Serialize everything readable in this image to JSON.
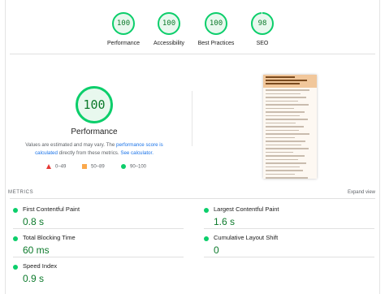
{
  "summary": [
    {
      "score": "100",
      "label": "Performance"
    },
    {
      "score": "100",
      "label": "Accessibility"
    },
    {
      "score": "100",
      "label": "Best Practices"
    },
    {
      "score": "98",
      "label": "SEO"
    }
  ],
  "performance": {
    "score": "100",
    "title": "Performance",
    "disclaimer_pre": "Values are estimated and may vary. The ",
    "disclaimer_link1": "performance score is calculated",
    "disclaimer_mid": " directly from these metrics. ",
    "disclaimer_link2": "See calculator."
  },
  "legend": {
    "fail": "0–49",
    "average": "50–89",
    "pass": "90–100"
  },
  "metrics": {
    "heading": "METRICS",
    "expand": "Expand view",
    "items": [
      {
        "label": "First Contentful Paint",
        "value": "0.8 s"
      },
      {
        "label": "Largest Contentful Paint",
        "value": "1.6 s"
      },
      {
        "label": "Total Blocking Time",
        "value": "60 ms"
      },
      {
        "label": "Cumulative Layout Shift",
        "value": "0"
      },
      {
        "label": "Speed Index",
        "value": "0.9 s"
      }
    ]
  },
  "colors": {
    "pass": "#0cce6b",
    "pass_text": "#0c7a2b",
    "average": "#fba94c",
    "fail": "#e53935",
    "link": "#1a73e8"
  }
}
